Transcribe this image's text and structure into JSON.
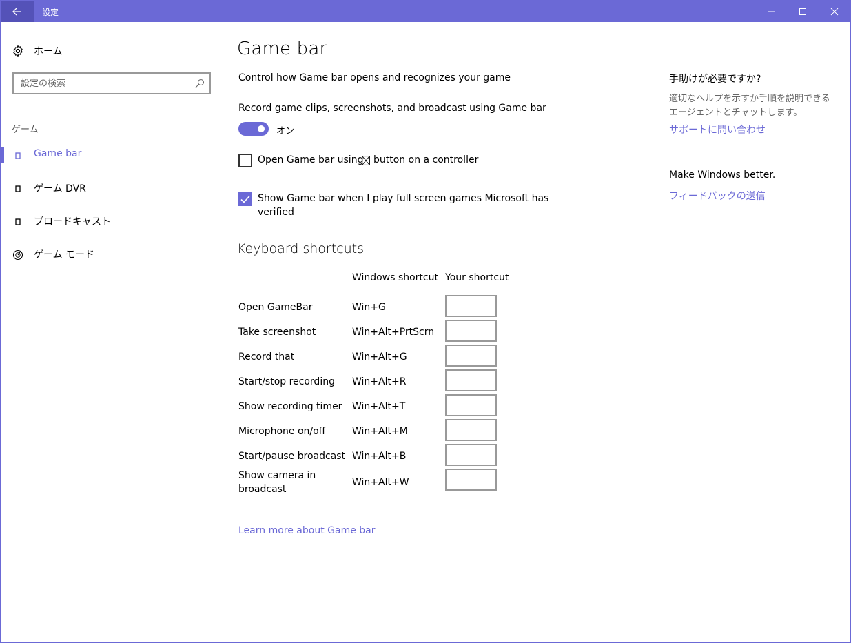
{
  "titlebar": {
    "title": "設定",
    "back_icon": "back-arrow-icon",
    "minimize_icon": "minimize-icon",
    "maximize_icon": "maximize-icon",
    "close_icon": "close-icon"
  },
  "sidebar": {
    "home_label": "ホーム",
    "search_placeholder": "設定の検索",
    "section": "ゲーム",
    "items": [
      {
        "label": "Game bar",
        "icon": "game-bar-icon",
        "active": true
      },
      {
        "label": "ゲーム DVR",
        "icon": "game-dvr-icon",
        "active": false
      },
      {
        "label": "ブロードキャスト",
        "icon": "broadcast-icon",
        "active": false
      },
      {
        "label": "ゲーム モード",
        "icon": "game-mode-icon",
        "active": false
      }
    ]
  },
  "main": {
    "title": "Game bar",
    "description": "Control how Game bar opens and recognizes your game",
    "record_label": "Record game clips, screenshots, and broadcast using Game bar",
    "toggle_state": "オン",
    "controller_pre": "Open Game bar using",
    "controller_post": "button on a controller",
    "controller_checked": false,
    "fullscreen_line1": "Show Game bar when I play full screen games Microsoft has",
    "fullscreen_line2": "verified",
    "fullscreen_checked": true,
    "shortcuts_title": "Keyboard shortcuts",
    "col_windows": "Windows shortcut",
    "col_yours": "Your shortcut",
    "shortcuts": [
      {
        "action": "Open GameBar",
        "keys": "Win+G"
      },
      {
        "action": "Take screenshot",
        "keys": "Win+Alt+PrtScrn"
      },
      {
        "action": "Record that",
        "keys": "Win+Alt+G"
      },
      {
        "action": "Start/stop recording",
        "keys": "Win+Alt+R"
      },
      {
        "action": "Show recording timer",
        "keys": "Win+Alt+T"
      },
      {
        "action": "Microphone on/off",
        "keys": "Win+Alt+M"
      },
      {
        "action": "Start/pause broadcast",
        "keys": "Win+Alt+B"
      },
      {
        "action_line1": "Show camera in",
        "action_line2": "broadcast",
        "keys": "Win+Alt+W"
      }
    ],
    "learn_more": "Learn more about Game bar"
  },
  "right": {
    "help_title": "手助けが必要ですか?",
    "help_desc_line1": "適切なヘルプを示すか手順を説明できる",
    "help_desc_line2": "エージェントとチャットします。",
    "support_link": "サポートに問い合わせ",
    "better_title": "Make Windows better.",
    "feedback_link": "フィードバックの送信"
  },
  "colors": {
    "accent": "#6b69d6",
    "titlebar": "#6b69d6",
    "back_button": "#5452b8"
  }
}
